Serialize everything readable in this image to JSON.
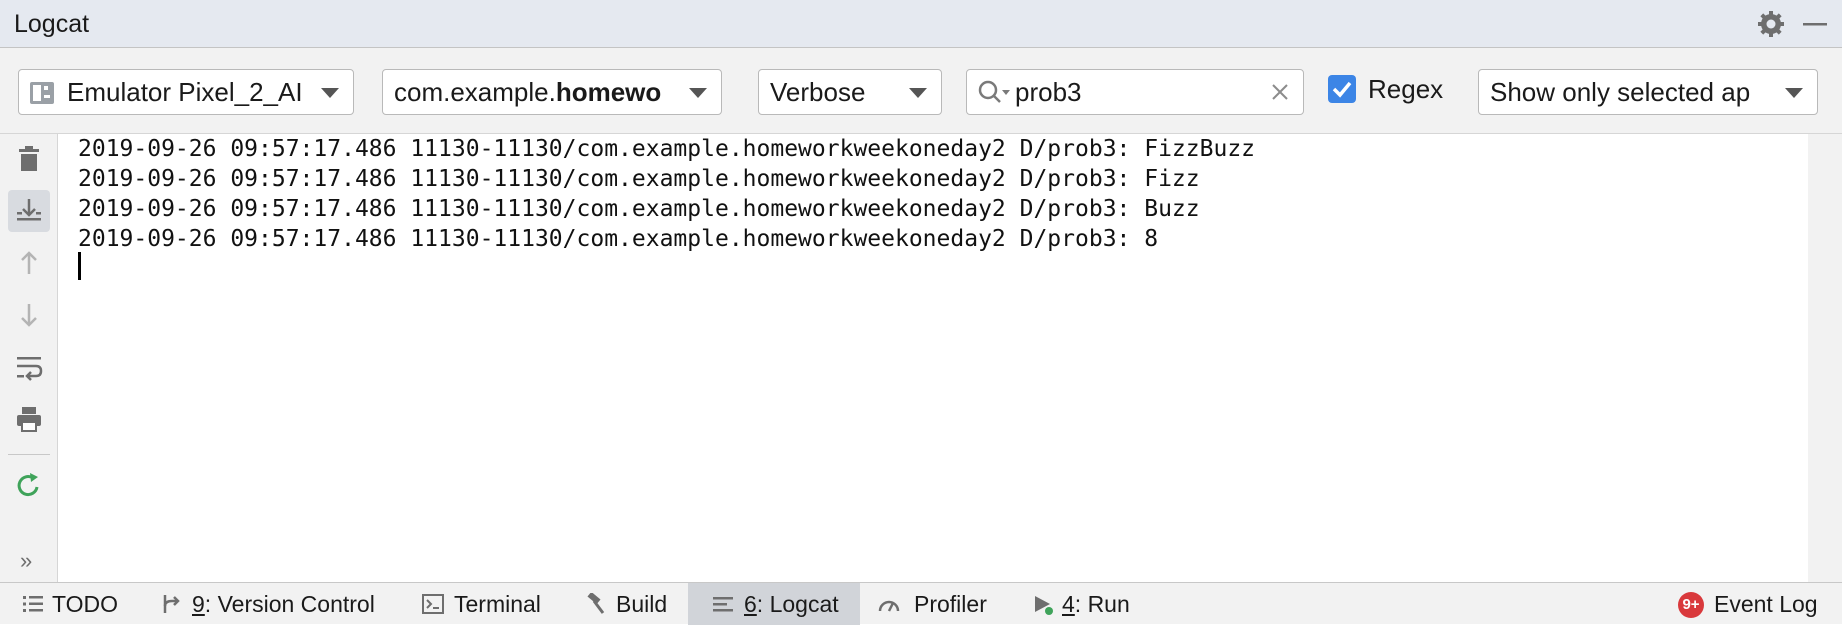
{
  "window": {
    "title": "Logcat"
  },
  "toolbar": {
    "device": {
      "label": "Emulator Pixel_2_AI"
    },
    "package": {
      "prefix": "com.example.",
      "bold": "homewo"
    },
    "level": {
      "label": "Verbose"
    },
    "search": {
      "value": "prob3"
    },
    "regex": {
      "label": "Regex",
      "checked": true
    },
    "filter": {
      "label": "Show only selected ap"
    }
  },
  "sidebar": {
    "buttons": [
      "trash-icon",
      "scroll-to-end-icon",
      "up-arrow-icon",
      "down-arrow-icon",
      "soft-wrap-icon",
      "print-icon",
      "restart-icon"
    ]
  },
  "log": {
    "lines": [
      "2019-09-26 09:57:17.486 11130-11130/com.example.homeworkweekoneday2 D/prob3: FizzBuzz",
      "2019-09-26 09:57:17.486 11130-11130/com.example.homeworkweekoneday2 D/prob3: Fizz",
      "2019-09-26 09:57:17.486 11130-11130/com.example.homeworkweekoneday2 D/prob3: Buzz",
      "2019-09-26 09:57:17.486 11130-11130/com.example.homeworkweekoneday2 D/prob3: 8"
    ]
  },
  "statusbar": {
    "todo": "TODO",
    "vcs": {
      "num": "9",
      "label": ": Version Control"
    },
    "terminal": "Terminal",
    "build": "Build",
    "logcat": {
      "num": "6",
      "label": ": Logcat"
    },
    "profiler": "Profiler",
    "run": {
      "num": "4",
      "label": ": Run"
    },
    "event_badge": "9+",
    "event_log": "Event Log"
  },
  "colors": {
    "accent": "#3c85e6",
    "badge": "#d9393c",
    "restart": "#3fa35a"
  }
}
